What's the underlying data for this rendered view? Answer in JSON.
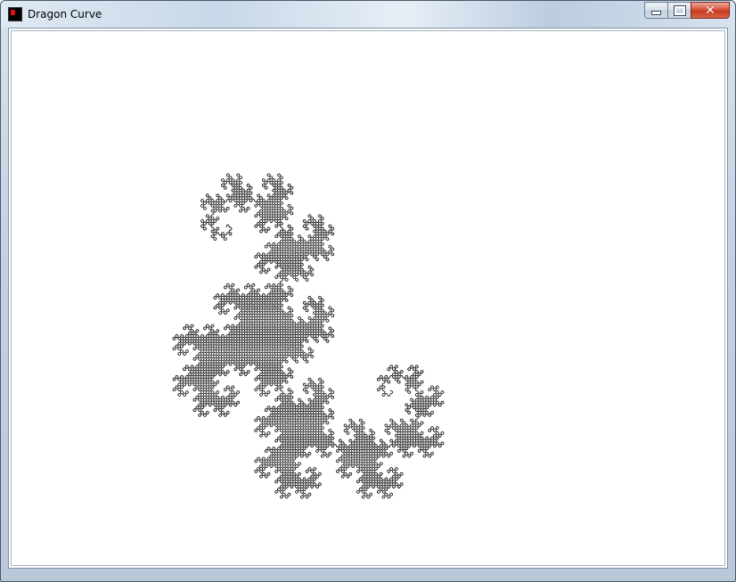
{
  "window": {
    "title": "Dragon Curve",
    "icon": "app-icon"
  },
  "caption_buttons": [
    {
      "name": "minimize-button",
      "icon": "minimize-icon"
    },
    {
      "name": "maximize-button",
      "icon": "maximize-icon"
    },
    {
      "name": "close-button",
      "icon": "close-icon"
    }
  ],
  "canvas": {
    "background": "#ffffff",
    "stroke_color": "#000000",
    "fractal": "dragon-curve"
  }
}
